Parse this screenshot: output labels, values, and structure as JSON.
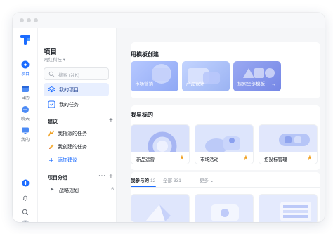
{
  "rail": {
    "items": [
      {
        "label": "项目",
        "icon": "project-icon",
        "active": true
      },
      {
        "label": "日历",
        "icon": "calendar-icon",
        "active": false
      },
      {
        "label": "聊天",
        "icon": "chat-icon",
        "active": false
      },
      {
        "label": "我的",
        "icon": "monitor-icon",
        "active": false
      }
    ],
    "bottom_icons": [
      "add-icon",
      "bell-icon",
      "search-icon",
      "avatar"
    ]
  },
  "sidebar": {
    "title": "项目",
    "subtitle": "网红科技",
    "search_placeholder": "搜索 (⌘K)",
    "nav": [
      {
        "label": "我的项目",
        "icon": "layers-icon",
        "active": true
      },
      {
        "label": "我的任务",
        "icon": "checkbox-icon",
        "active": false
      }
    ],
    "suggestions_title": "建议",
    "suggestions": [
      {
        "label": "我指派的任务",
        "icon": "assign-icon"
      },
      {
        "label": "我创建的任务",
        "icon": "pencil-icon"
      },
      {
        "label": "添加建议",
        "icon": "plus-icon",
        "add": true
      }
    ],
    "groups_title": "项目分组",
    "groups": [
      {
        "label": "战略规划",
        "count": "6"
      }
    ]
  },
  "main": {
    "templates_title": "用模板创建",
    "templates": [
      {
        "label": "市场营销"
      },
      {
        "label": "产品设计"
      },
      {
        "label": "探索全部模板",
        "arrow": "→"
      }
    ],
    "starred_title": "我星标的",
    "starred": [
      {
        "label": "新品运营",
        "star": "★"
      },
      {
        "label": "市场活动",
        "star": "★"
      },
      {
        "label": "招投标管理",
        "star": "★"
      }
    ],
    "tabs": [
      {
        "label": "我参与的",
        "count": "12",
        "active": true
      },
      {
        "label": "全部",
        "count": "331",
        "active": false
      },
      {
        "label": "更多",
        "count": "⌄",
        "active": false
      }
    ]
  },
  "colors": {
    "accent": "#1c6cff",
    "star": "#f0a020",
    "main_bg": "#f5f6f8"
  }
}
